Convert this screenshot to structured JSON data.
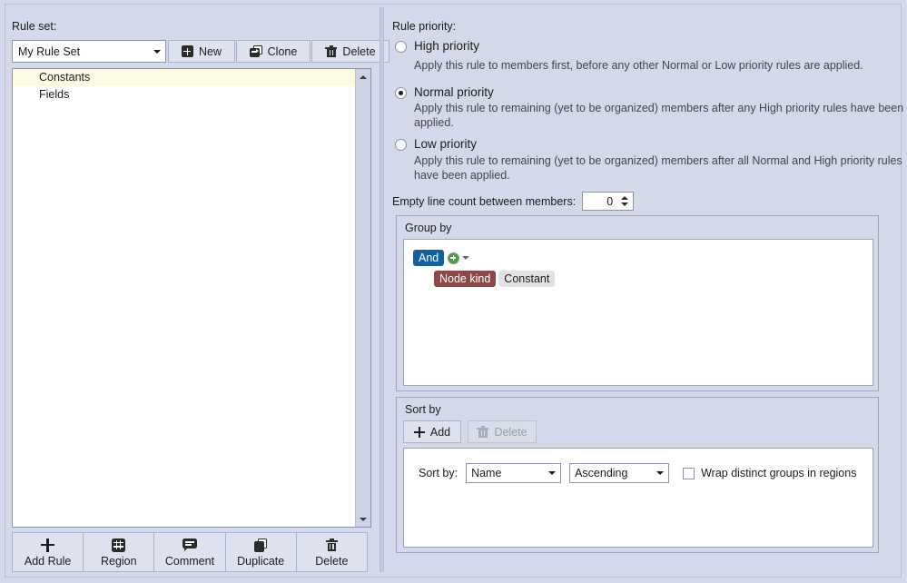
{
  "left": {
    "ruleset_label": "Rule set:",
    "ruleset_value": "My Rule Set",
    "buttons": [
      {
        "label": "New",
        "icon": "plus-square-icon"
      },
      {
        "label": "Clone",
        "icon": "clone-icon"
      },
      {
        "label": "Delete",
        "icon": "trash-icon"
      }
    ],
    "rules": [
      {
        "label": "Constants",
        "selected": true
      },
      {
        "label": "Fields",
        "selected": false
      }
    ],
    "toolbar": [
      {
        "label": "Add Rule",
        "icon": "plus-icon"
      },
      {
        "label": "Region",
        "icon": "region-icon"
      },
      {
        "label": "Comment",
        "icon": "comment-icon"
      },
      {
        "label": "Duplicate",
        "icon": "duplicate-icon"
      },
      {
        "label": "Delete",
        "icon": "trash-icon"
      }
    ]
  },
  "right": {
    "priority_label": "Rule priority:",
    "priorities": [
      {
        "label": "High priority",
        "checked": false,
        "description": "Apply this rule to members first, before any other Normal or Low priority rules are applied."
      },
      {
        "label": "Normal priority",
        "checked": true,
        "description": "Apply this rule to remaining (yet to be organized) members after any High priority rules have been applied."
      },
      {
        "label": "Low priority",
        "checked": false,
        "description": "Apply this rule to remaining (yet to be organized) members after all Normal and High priority rules have been applied."
      }
    ],
    "empty_line": {
      "label": "Empty line count between members:",
      "value": "0"
    },
    "group_by": {
      "title": "Group by",
      "operator": "And",
      "condition_key": "Node kind",
      "condition_value": "Constant"
    },
    "sort_by": {
      "title": "Sort by",
      "add_label": "Add",
      "delete_label": "Delete",
      "row_label": "Sort by:",
      "field_value": "Name",
      "direction_value": "Ascending",
      "wrap_label": "Wrap distinct groups in regions",
      "wrap_checked": false
    }
  },
  "colors": {
    "background": "#d3d9e8",
    "accent_and_chip": "#12609f",
    "key_chip": "#8c4a47",
    "value_chip": "#e2e2e2",
    "selection": "#fdfbe4",
    "add_green": "#4a9c4a"
  }
}
